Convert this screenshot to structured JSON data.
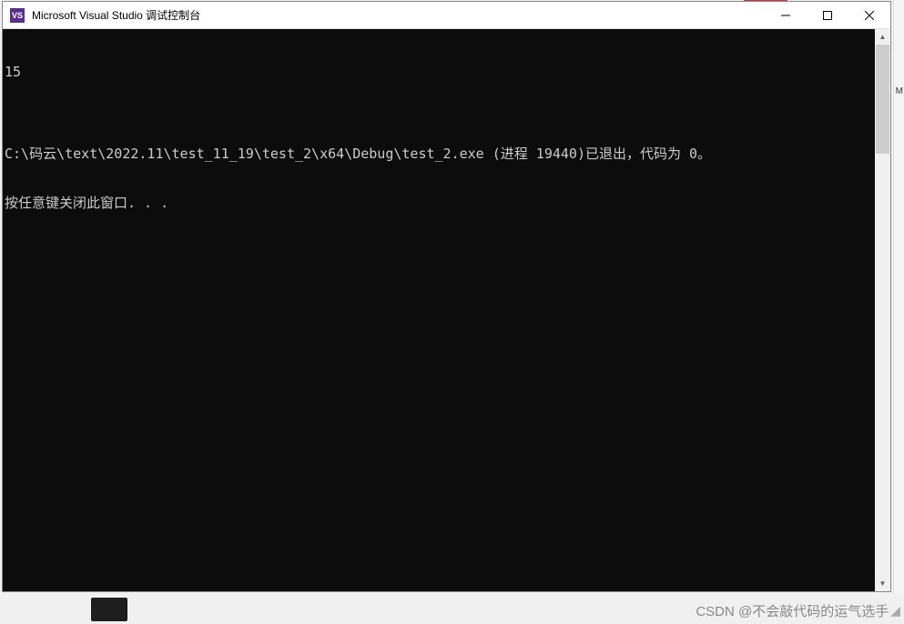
{
  "titlebar": {
    "icon_label": "VS",
    "title": "Microsoft Visual Studio 调试控制台"
  },
  "console": {
    "lines": [
      "15",
      "",
      "C:\\码云\\text\\2022.11\\test_11_19\\test_2\\x64\\Debug\\test_2.exe (进程 19440)已退出，代码为 0。",
      "按任意键关闭此窗口. . ."
    ]
  },
  "watermark": {
    "text": "CSDN @不会敲代码的运气选手"
  },
  "right_edge": {
    "char": "M"
  }
}
